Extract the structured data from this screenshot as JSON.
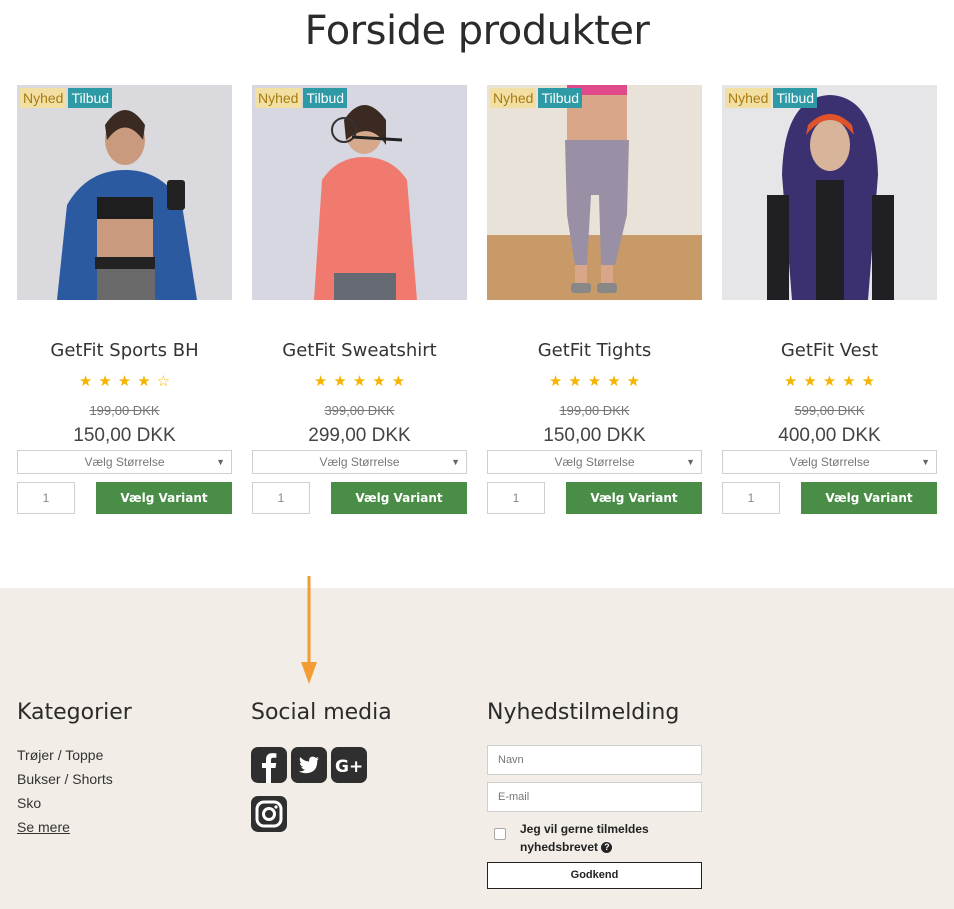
{
  "page": {
    "title": "Forside produkter"
  },
  "badges": {
    "new": "Nyhed",
    "sale": "Tilbud"
  },
  "products": [
    {
      "name": "GetFit Sports BH",
      "rating": 4,
      "old_price": "199,00 DKK",
      "price": "150,00 DKK",
      "size_placeholder": "Vælg Størrelse",
      "qty": "1",
      "button": "Vælg Variant"
    },
    {
      "name": "GetFit Sweatshirt",
      "rating": 5,
      "old_price": "399,00 DKK",
      "price": "299,00 DKK",
      "size_placeholder": "Vælg Størrelse",
      "qty": "1",
      "button": "Vælg Variant"
    },
    {
      "name": "GetFit Tights",
      "rating": 5,
      "old_price": "199,00 DKK",
      "price": "150,00 DKK",
      "size_placeholder": "Vælg Størrelse",
      "qty": "1",
      "button": "Vælg Variant"
    },
    {
      "name": "GetFit Vest",
      "rating": 5,
      "old_price": "599,00 DKK",
      "price": "400,00 DKK",
      "size_placeholder": "Vælg Størrelse",
      "qty": "1",
      "button": "Vælg Variant"
    }
  ],
  "footer": {
    "categories": {
      "title": "Kategorier",
      "items": [
        "Trøjer / Toppe",
        "Bukser / Shorts",
        "Sko"
      ],
      "more": "Se mere"
    },
    "social": {
      "title": "Social media",
      "icons": [
        "facebook-icon",
        "twitter-icon",
        "google-plus-icon",
        "instagram-icon"
      ]
    },
    "newsletter": {
      "title": "Nyhedstilmelding",
      "name_placeholder": "Navn",
      "email_placeholder": "E-mail",
      "consent_label": "Jeg vil gerne tilmeldes nyhedsbrevet",
      "submit": "Godkend"
    }
  },
  "colors": {
    "accent_green": "#4a8d47",
    "badge_new": "#f2dfa2",
    "badge_sale": "#2d9aa5",
    "footer_bg": "#f2ede6",
    "arrow": "#f39c33",
    "star": "#f5b400"
  }
}
